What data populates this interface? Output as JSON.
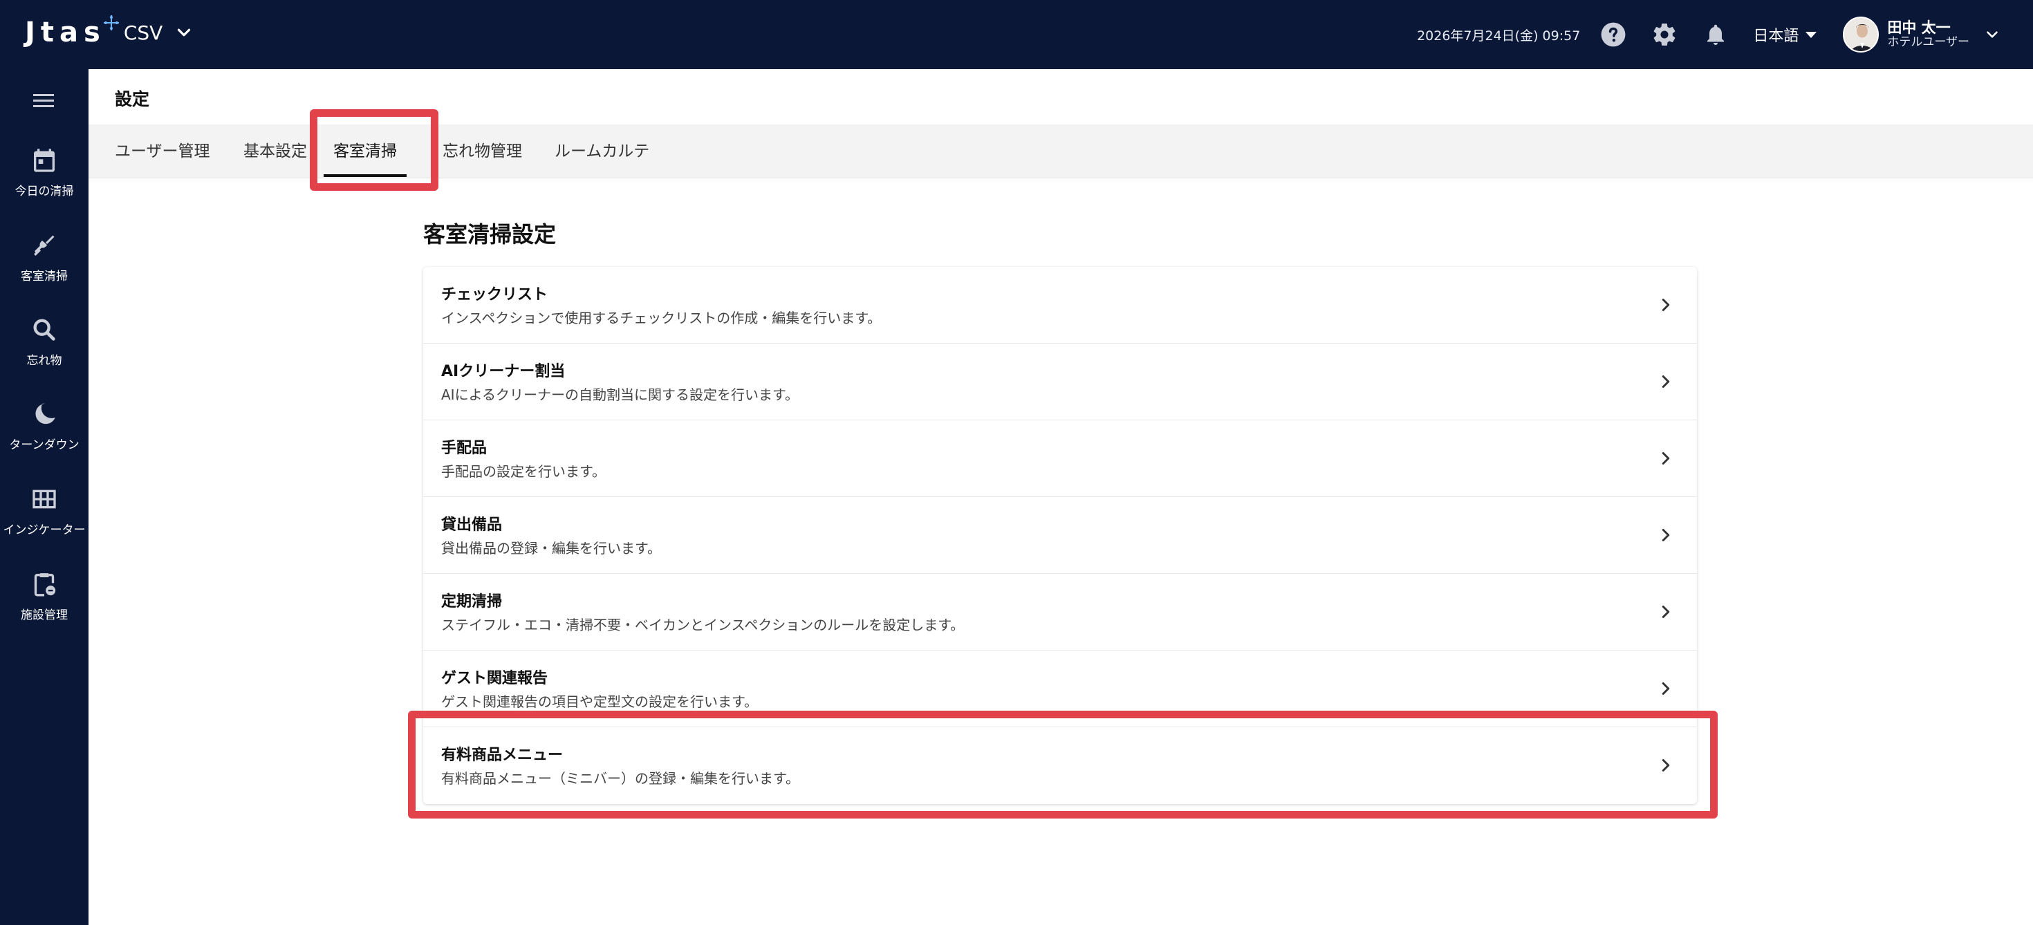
{
  "topbar": {
    "brand": "Jtas",
    "selector_label": "CSV",
    "datetime": "2026年7月24日(金) 09:57",
    "language": "日本語",
    "user_name": "田中 太一",
    "user_role": "ホテルユーザー",
    "icons": [
      "help-icon",
      "gear-icon",
      "bell-icon",
      "chevron-down-icon"
    ]
  },
  "sidebar": {
    "items": [
      {
        "label": "今日の清掃",
        "icon": "calendar-icon"
      },
      {
        "label": "客室清掃",
        "icon": "broom-icon"
      },
      {
        "label": "忘れ物",
        "icon": "search-icon"
      },
      {
        "label": "ターンダウン",
        "icon": "moon-icon"
      },
      {
        "label": "インジケーター",
        "icon": "grid-icon"
      },
      {
        "label": "施設管理",
        "icon": "clipboard-icon"
      }
    ]
  },
  "page": {
    "title": "設定",
    "tabs": [
      {
        "label": "ユーザー管理"
      },
      {
        "label": "基本設定"
      },
      {
        "label": "客室清掃",
        "active": true
      },
      {
        "label": "忘れ物管理"
      },
      {
        "label": "ルームカルテ"
      }
    ],
    "section_title": "客室清掃設定",
    "settings": [
      {
        "title": "チェックリスト",
        "desc": "インスペクションで使用するチェックリストの作成・編集を行います。"
      },
      {
        "title": "AIクリーナー割当",
        "desc": "AIによるクリーナーの自動割当に関する設定を行います。"
      },
      {
        "title": "手配品",
        "desc": "手配品の設定を行います。"
      },
      {
        "title": "貸出備品",
        "desc": "貸出備品の登録・編集を行います。"
      },
      {
        "title": "定期清掃",
        "desc": "ステイフル・エコ・清掃不要・ベイカンとインスペクションのルールを設定します。"
      },
      {
        "title": "ゲスト関連報告",
        "desc": "ゲスト関連報告の項目や定型文の設定を行います。"
      },
      {
        "title": "有料商品メニュー",
        "desc": "有料商品メニュー（ミニバー）の登録・編集を行います。"
      }
    ]
  },
  "colors": {
    "nav_bg": "#0a1736",
    "highlight": "#e2434b",
    "tab_bar_bg": "#f3f3f3"
  }
}
